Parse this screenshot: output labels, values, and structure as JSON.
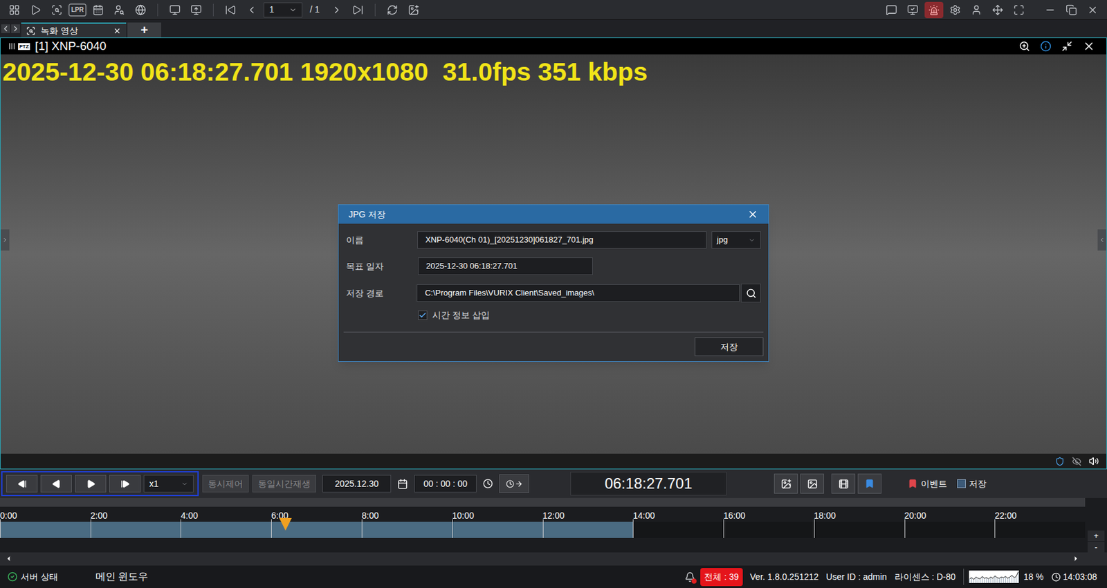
{
  "toolbar": {
    "lpr_label": "LPR",
    "page": "1",
    "page_total": "/ 1"
  },
  "tabs": [
    {
      "label": "녹화 영상",
      "selected": true
    }
  ],
  "add_tab": "+",
  "panel": {
    "ptz_badge": "PTZ",
    "title": "[1] XNP-6040",
    "osd": "2025-12-30 06:18:27.701 1920x1080  31.0fps 351 kbps"
  },
  "dialog": {
    "title": "JPG 저장",
    "name_label": "이름",
    "name_value": "XNP-6040(Ch 01)_[20251230]061827_701.jpg",
    "format": "jpg",
    "date_label": "목표 일자",
    "date_value": "2025-12-30 06:18:27.701",
    "path_label": "저장 경로",
    "path_value": "C:\\Program Files\\VURIX Client\\Saved_images\\",
    "checkbox": {
      "label": "시간 정보 삽입",
      "checked": true
    },
    "save_button": "저장"
  },
  "controls": {
    "speed": "x1",
    "sync_control": {
      "label": "동시제어",
      "disabled": true
    },
    "same_time": {
      "label": "동일시간재생",
      "disabled": true
    },
    "date": "2025.12.30",
    "time": "00 : 00 : 00",
    "current_time": "06:18:27.701",
    "legend": [
      {
        "label": "이벤트",
        "color": "#e0454b",
        "kind": "marker"
      },
      {
        "label": "저장",
        "color": "#3c5a78",
        "kind": "box"
      }
    ]
  },
  "timeline": {
    "ticks": [
      "0:00",
      "2:00",
      "4:00",
      "6:00",
      "8:00",
      "10:00",
      "12:00",
      "14:00",
      "16:00",
      "18:00",
      "20:00",
      "22:00"
    ],
    "recorded_level": 0.584,
    "position_level": 0.263,
    "zoom_in": "+",
    "zoom_out": "-"
  },
  "status_bar": {
    "server_status": "서버 상태",
    "window": "메인 윈도우",
    "alarm_total": "전체 : 39",
    "version": "Ver. 1.8.0.251212",
    "user": "User ID : admin",
    "license": "라이센스 : D-80",
    "cpu": "18 %",
    "cpu_history": [
      6,
      8,
      5,
      9,
      7,
      6,
      10,
      7,
      8,
      6,
      9,
      7,
      11,
      8,
      7,
      9,
      8,
      10,
      7,
      9,
      12,
      8,
      10,
      18
    ],
    "clock": "14:03:08"
  }
}
